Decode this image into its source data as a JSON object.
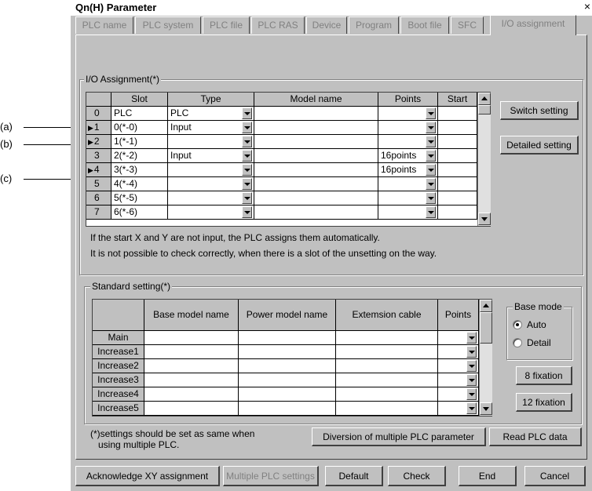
{
  "callouts": [
    "(a)",
    "(b)",
    "(c)"
  ],
  "window": {
    "title": "Qn(H) Parameter",
    "close_glyph": "×"
  },
  "tabs": [
    "PLC name",
    "PLC system",
    "PLC file",
    "PLC RAS",
    "Device",
    "Program",
    "Boot file",
    "SFC",
    "I/O assignment"
  ],
  "io": {
    "group_title": "I/O Assignment(*)",
    "columns": [
      "Slot",
      "Type",
      "Model name",
      "Points",
      "Start"
    ],
    "rows": [
      {
        "idx": "0",
        "marker": "",
        "slot": "PLC",
        "type": "PLC",
        "model": "",
        "points": "",
        "start": ""
      },
      {
        "idx": "1",
        "marker": "▶",
        "slot": "0(*-0)",
        "type": "Input",
        "model": "",
        "points": "",
        "start": ""
      },
      {
        "idx": "2",
        "marker": "▶",
        "slot": "1(*-1)",
        "type": "",
        "model": "",
        "points": "",
        "start": ""
      },
      {
        "idx": "3",
        "marker": "",
        "slot": "2(*-2)",
        "type": "Input",
        "model": "",
        "points": "16points",
        "start": ""
      },
      {
        "idx": "4",
        "marker": "▶",
        "slot": "3(*-3)",
        "type": "",
        "model": "",
        "points": "16points",
        "start": ""
      },
      {
        "idx": "5",
        "marker": "",
        "slot": "4(*-4)",
        "type": "",
        "model": "",
        "points": "",
        "start": ""
      },
      {
        "idx": "6",
        "marker": "",
        "slot": "5(*-5)",
        "type": "",
        "model": "",
        "points": "",
        "start": ""
      },
      {
        "idx": "7",
        "marker": "",
        "slot": "6(*-6)",
        "type": "",
        "model": "",
        "points": "",
        "start": ""
      }
    ],
    "switch_setting": "Switch setting",
    "detailed_setting": "Detailed setting",
    "note1": "If the start X and Y are not input, the PLC assigns them automatically.",
    "note2": "It is not possible to check correctly, when there is a slot of the unsetting on the way."
  },
  "standard": {
    "group_title": "Standard setting(*)",
    "columns": [
      "Base model name",
      "Power model name",
      "Extemsion cable",
      "Points"
    ],
    "rows": [
      "Main",
      "Increase1",
      "Increase2",
      "Increase3",
      "Increase4",
      "Increase5"
    ],
    "base_mode": {
      "title": "Base mode",
      "options": [
        "Auto",
        "Detail"
      ],
      "selected": "Auto"
    },
    "fix8": "8 fixation",
    "fix12": "12 fixation"
  },
  "footer_note": [
    "(*)settings should be set as same when",
    "using multiple PLC."
  ],
  "diversion_button": "Diversion of multiple PLC parameter",
  "read_plc_button": "Read PLC data",
  "bottom_buttons": {
    "ack": "Acknowledge XY assignment",
    "multiple": "Multiple PLC settings",
    "default": "Default",
    "check": "Check",
    "end": "End",
    "cancel": "Cancel"
  }
}
